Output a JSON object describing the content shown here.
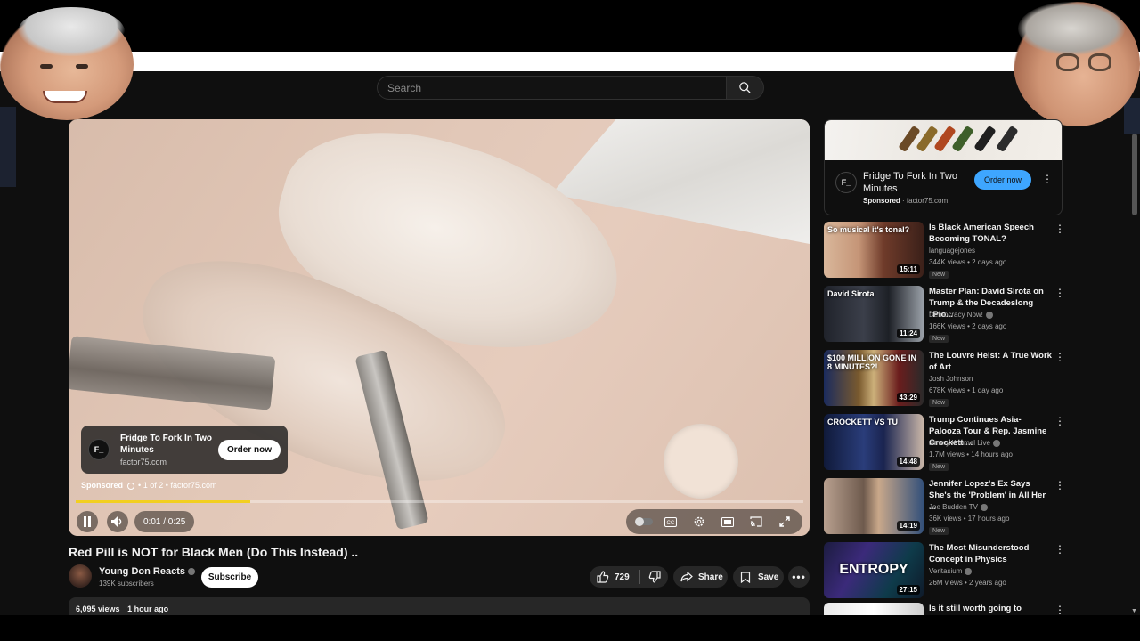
{
  "search": {
    "placeholder": "Search"
  },
  "player": {
    "ad": {
      "logo": "F_",
      "title": "Fridge To Fork In Two Minutes",
      "url": "factor75.com",
      "cta": "Order now",
      "sponsored": "Sponsored",
      "ad_count": "1 of 2",
      "sponsor_domain": "factor75.com"
    },
    "time": "0:01 / 0:25",
    "progress_fraction": 0.24,
    "progress_color": "#f2cf20"
  },
  "video": {
    "title": "Red Pill is NOT for Black Men (Do This Instead) ..",
    "channel": "Young Don Reacts",
    "subscribers": "139K subscribers",
    "subscribe_label": "Subscribe",
    "likes": "729",
    "share_label": "Share",
    "save_label": "Save",
    "views": "6,095 views",
    "posted": "1 hour ago"
  },
  "sidebar_ad": {
    "logo": "F_",
    "title": "Fridge To Fork In Two Minutes",
    "sponsored": "Sponsored",
    "domain": "factor75.com",
    "cta": "Order now",
    "cta_color": "#3ea6ff"
  },
  "recommendations": [
    {
      "title": "Is Black American Speech Becoming TONAL?",
      "channel": "languagejones",
      "verified": false,
      "views": "344K views",
      "age": "2 days ago",
      "new": "New",
      "duration": "15:11",
      "thumb_text": "So musical it's tonal?"
    },
    {
      "title": "Master Plan: David Sirota on Trump & the Decadeslong \"Plo...",
      "channel": "Democracy Now!",
      "verified": true,
      "views": "166K views",
      "age": "2 days ago",
      "new": "New",
      "duration": "11:24",
      "thumb_text": "David Sirota"
    },
    {
      "title": "The Louvre Heist: A True Work of Art",
      "channel": "Josh Johnson",
      "verified": false,
      "views": "678K views",
      "age": "1 day ago",
      "new": "New",
      "duration": "43:29",
      "thumb_text": "$100 MILLION GONE IN 8 MINUTES?!"
    },
    {
      "title": "Trump Continues Asia-Palooza Tour & Rep. Jasmine Crockett ...",
      "channel": "Jimmy Kimmel Live",
      "verified": true,
      "views": "1.7M views",
      "age": "14 hours ago",
      "new": "New",
      "duration": "14:48",
      "thumb_text": "CROCKETT VS TU"
    },
    {
      "title": "Jennifer Lopez's Ex Says She's the 'Problem' in All Her ...",
      "channel": "Joe Budden TV",
      "verified": true,
      "views": "36K views",
      "age": "17 hours ago",
      "new": "New",
      "duration": "14:19",
      "thumb_text": ""
    },
    {
      "title": "The Most Misunderstood Concept in Physics",
      "channel": "Veritasium",
      "verified": true,
      "views": "26M views",
      "age": "2 years ago",
      "new": "",
      "duration": "27:15",
      "thumb_text": "ENTROPY"
    },
    {
      "title": "Is it still worth going to",
      "channel": "",
      "verified": false,
      "views": "",
      "age": "",
      "new": "",
      "duration": "",
      "thumb_text": ""
    }
  ]
}
